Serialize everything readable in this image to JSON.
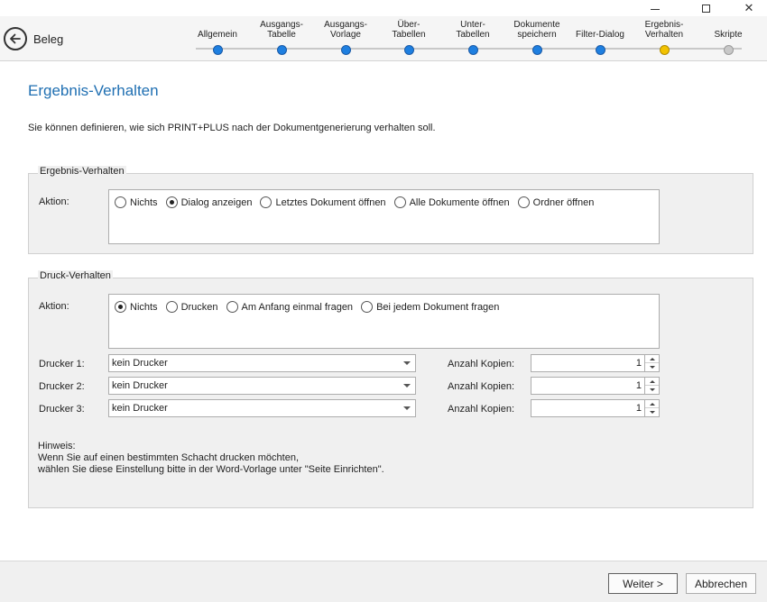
{
  "window": {
    "minimize_glyph": "—",
    "maximize_glyph": "□",
    "close_glyph": "✕"
  },
  "header": {
    "title": "Beleg",
    "back_icon": "back-arrow-icon",
    "steps": [
      {
        "label": "Allgemein",
        "state": "done"
      },
      {
        "label": "Ausgangs-\nTabelle",
        "state": "done"
      },
      {
        "label": "Ausgangs-\nVorlage",
        "state": "done"
      },
      {
        "label": "Über-\nTabellen",
        "state": "done"
      },
      {
        "label": "Unter-\nTabellen",
        "state": "done"
      },
      {
        "label": "Dokumente\nspeichern",
        "state": "done"
      },
      {
        "label": "Filter-Dialog",
        "state": "done"
      },
      {
        "label": "Ergebnis-\nVerhalten",
        "state": "current"
      },
      {
        "label": "Skripte",
        "state": "pending"
      }
    ],
    "colors": {
      "done": "#1e7fe0",
      "current": "#f2c200",
      "pending": "#c8c8c8"
    }
  },
  "main": {
    "heading": "Ergebnis-Verhalten",
    "intro": "Sie können definieren, wie sich PRINT+PLUS nach der Dokumentgenerierung verhalten soll."
  },
  "result_group": {
    "title": "Ergebnis-Verhalten",
    "action_label": "Aktion:",
    "options": [
      {
        "label": "Nichts",
        "checked": false
      },
      {
        "label": "Dialog anzeigen",
        "checked": true
      },
      {
        "label": "Letztes Dokument öffnen",
        "checked": false
      },
      {
        "label": "Alle Dokumente öffnen",
        "checked": false
      },
      {
        "label": "Ordner öffnen",
        "checked": false
      }
    ]
  },
  "print_group": {
    "title": "Druck-Verhalten",
    "action_label": "Aktion:",
    "options": [
      {
        "label": "Nichts",
        "checked": true
      },
      {
        "label": "Drucken",
        "checked": false
      },
      {
        "label": "Am Anfang einmal fragen",
        "checked": false
      },
      {
        "label": "Bei jedem Dokument fragen",
        "checked": false
      }
    ],
    "printers": [
      {
        "label": "Drucker 1:",
        "value": "kein Drucker",
        "copies_label": "Anzahl Kopien:",
        "copies": "1"
      },
      {
        "label": "Drucker 2:",
        "value": "kein Drucker",
        "copies_label": "Anzahl Kopien:",
        "copies": "1"
      },
      {
        "label": "Drucker 3:",
        "value": "kein Drucker",
        "copies_label": "Anzahl Kopien:",
        "copies": "1"
      }
    ],
    "hint_title": "Hinweis:",
    "hint_line1": "Wenn Sie auf einen bestimmten Schacht drucken möchten,",
    "hint_line2": "wählen Sie diese Einstellung bitte in der Word-Vorlage unter \"Seite Einrichten\"."
  },
  "footer": {
    "next_label": "Weiter >",
    "cancel_label": "Abbrechen"
  }
}
